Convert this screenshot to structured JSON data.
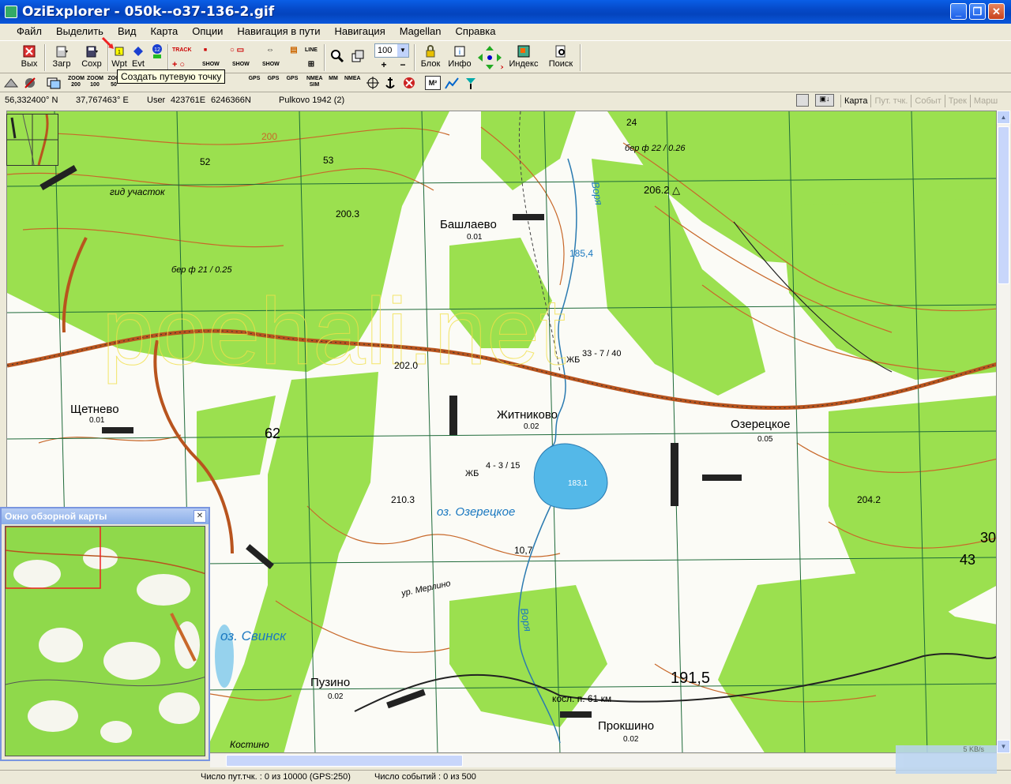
{
  "window": {
    "title": "OziExplorer - 050k--o37-136-2.gif",
    "minimize": "_",
    "maximize": "❐",
    "close": "✕"
  },
  "menu": [
    "Файл",
    "Выделить",
    "Вид",
    "Карта",
    "Опции",
    "Навигация в пути",
    "Навигация",
    "Magellan",
    "Справка"
  ],
  "toolbar": {
    "exit": "Вых",
    "load": "Загр",
    "save": "Сохр",
    "wpt": "Wpt",
    "evt": "Evt",
    "zoom_value": "100",
    "block": "Блок",
    "info": "Инфо",
    "index": "Индекс",
    "search": "Поиск",
    "track": "TRACK",
    "show": "SHOW",
    "line": "LINE",
    "gps": "GPS"
  },
  "toolbar2": {
    "zoom200": "ZOOM 200",
    "zoom100": "ZOOM 100",
    "zoom50": "ZOO 50",
    "full": "FULL",
    "nmea_sim": "NMEA SIM",
    "mm": "MM",
    "nmea": "NMEA",
    "m2": "M²"
  },
  "tooltip": "Создать путевую точку",
  "coords": {
    "lat": "56,332400° N",
    "lon": "37,767463° E",
    "user_label": "User",
    "easting": "423761E",
    "northing": "6246366N",
    "datum": "Pulkovo 1942 (2)"
  },
  "map_tabs": [
    "Карта",
    "Пут. тчк.",
    "Событ",
    "Трек",
    "Марш"
  ],
  "map_labels": {
    "bashlaevo": "Башлаево",
    "bashlaevo_v": "0.01",
    "shchetnevo": "Щетнево",
    "shchetnevo_v": "0.01",
    "zhitnikovo": "Житниково",
    "zhitnikovo_v": "0.02",
    "ozeretskoe": "Озерецкое",
    "ozeretskoe_v": "0.05",
    "lake": "оз. Озерецкое",
    "lake_depth": "183,1",
    "svinsk": "оз. Свинск",
    "puzino": "Пузино",
    "puzino_v": "0.02",
    "prokshino": "Прокшино",
    "prokshino_v": "0.02",
    "voria1": "Воря",
    "voria2": "Воря",
    "h2003": "200.3",
    "h2062": "206.2 △",
    "h2020": "202.0",
    "h2103": "210.3",
    "h2042": "204.2",
    "h1915": "191,5",
    "h1854": "185,4",
    "n62": "62",
    "n200": "200",
    "n52": "52",
    "n53": "53",
    "uchastok": "гид участок",
    "merlino": "ур. Мерлино",
    "kosp": "косл. п. 61 км",
    "kostino": "Костино",
    "zhb1": "ЖБ",
    "zhb1_v": "33 - 7 / 40",
    "zhb2": "ЖБ",
    "zhb2_v": "4 - 3 / 15",
    "n107": "10,7",
    "bereza1": "бер ф 21 / 0.25",
    "bereza2": "бер ф 22 / 0.26",
    "n43": "43",
    "n30": "30",
    "n24": "24"
  },
  "overview": {
    "title": "Окно обзорной карты",
    "close": "✕"
  },
  "status": {
    "waypoints": "Число пут.тчк. : 0 из 10000  (GPS:250)",
    "events": "Число событий : 0 из 500"
  },
  "corner_label": "5 KB/s",
  "colors": {
    "forest": "#9be04f",
    "open": "#fbfbf6",
    "road": "#b8541e",
    "contour": "#c8682a",
    "water": "#54b8e8",
    "grid": "#1f6a3a"
  }
}
